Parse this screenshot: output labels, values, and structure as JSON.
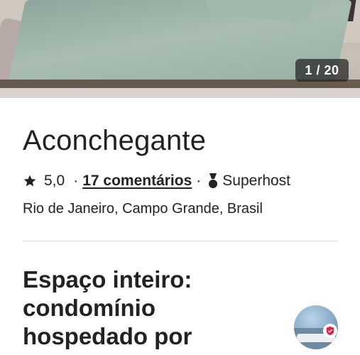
{
  "gallery": {
    "counter": "1 / 20"
  },
  "listing": {
    "title": "Aconchegante",
    "rating": "5,0",
    "separator": "·",
    "reviews_label": "17 comentários",
    "host_badge_label": "Superhost",
    "location": "Rio de Janeiro, Campo Grande, Brasil"
  },
  "host_section": {
    "heading_lines": [
      "Espaço inteiro:",
      "condomínio",
      "hospedado por"
    ]
  },
  "colors": {
    "text": "#222222",
    "divider": "#dddddd",
    "counter_bg": "rgba(34,34,34,0.72)",
    "superhost_badge": "#e61e4d"
  },
  "icons": {
    "rating": "star-icon",
    "superhost": "medal-icon"
  }
}
